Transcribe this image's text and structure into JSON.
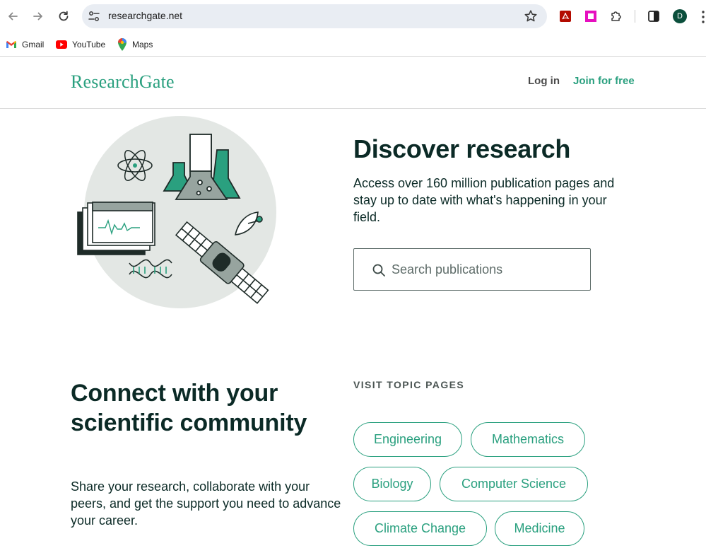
{
  "browser": {
    "url": "researchgate.net",
    "profile_initial": "D",
    "bookmarks": [
      {
        "label": "Gmail",
        "icon": "gmail-icon"
      },
      {
        "label": "YouTube",
        "icon": "youtube-icon"
      },
      {
        "label": "Maps",
        "icon": "maps-icon"
      }
    ]
  },
  "header": {
    "logo": "ResearchGate",
    "login": "Log in",
    "join": "Join for free"
  },
  "hero": {
    "title": "Discover research",
    "subtitle": "Access over 160 million publication pages and stay up to date with what's happening in your field.",
    "search_placeholder": "Search publications"
  },
  "community": {
    "title": "Connect with your scientific community",
    "subtitle": "Share your research, collaborate with your peers, and get the support you need to advance your career."
  },
  "topics": {
    "label": "VISIT TOPIC PAGES",
    "items": [
      "Engineering",
      "Mathematics",
      "Biology",
      "Computer Science",
      "Climate Change",
      "Medicine"
    ]
  },
  "colors": {
    "brand": "#2aa07f",
    "text": "#0b2a26"
  }
}
